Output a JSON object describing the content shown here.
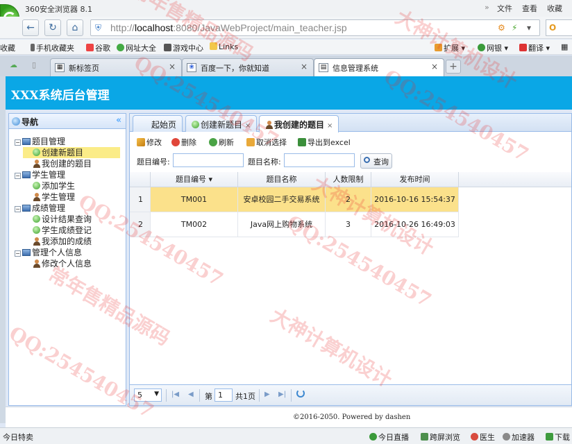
{
  "browser": {
    "app_title": "360安全浏览器 8.1",
    "menu": [
      "文件",
      "查看",
      "收藏"
    ],
    "menu_more": "»",
    "url_host": "localhost",
    "url_rest": ":8080/JavaWebProject/main_teacher.jsp",
    "url_scheme": "http://",
    "bookmarks": [
      "收藏",
      "手机收藏夹",
      "谷歌",
      "网址大全",
      "游戏中心",
      "Links"
    ],
    "bookmark_right": [
      "扩展",
      "网银",
      "翻译"
    ],
    "tabs": [
      {
        "label": "新标签页"
      },
      {
        "label": "百度一下，你就知道"
      },
      {
        "label": "信息管理系统"
      }
    ],
    "tab_close": "×",
    "new_tab": "+"
  },
  "app": {
    "header_title": "XXX系统后台管理",
    "nav_title": "导航",
    "nav_collapse": "«",
    "tree": [
      {
        "label": "题目管理",
        "type": "group"
      },
      {
        "label": "创建新题目",
        "type": "ok"
      },
      {
        "label": "我创建的题目",
        "type": "user"
      },
      {
        "label": "学生管理",
        "type": "group"
      },
      {
        "label": "添加学生",
        "type": "ok"
      },
      {
        "label": "学生管理",
        "type": "user"
      },
      {
        "label": "成绩管理",
        "type": "group"
      },
      {
        "label": "设计结果查询",
        "type": "ok"
      },
      {
        "label": "学生成绩登记",
        "type": "ok"
      },
      {
        "label": "我添加的成绩",
        "type": "user"
      },
      {
        "label": "管理个人信息",
        "type": "group"
      },
      {
        "label": "修改个人信息",
        "type": "user"
      }
    ],
    "panel_tabs": [
      "起始页",
      "创建新题目",
      "我创建的题目"
    ],
    "panel_tab_close": "×",
    "toolbar": {
      "edit": "修改",
      "delete": "删除",
      "refresh": "刷新",
      "cancel_select": "取消选择",
      "export": "导出到excel"
    },
    "query": {
      "id_label": "题目编号:",
      "name_label": "题目名称:",
      "search_btn": "查询",
      "id_value": "",
      "name_value": ""
    },
    "grid": {
      "columns": [
        "题目编号",
        "题目名称",
        "人数限制",
        "发布时间"
      ],
      "sort_indicator": "▾",
      "rows": [
        {
          "num": "1",
          "id": "TM001",
          "name": "安卓校园二手交易系统",
          "limit": "2",
          "time": "2016-10-16 15:54:37"
        },
        {
          "num": "2",
          "id": "TM002",
          "name": "Java网上购物系统",
          "limit": "3",
          "time": "2016-10-26 16:49:03"
        }
      ]
    },
    "pager": {
      "page_size": "5",
      "page_prefix": "第",
      "page_value": "1",
      "page_total": "共1页"
    },
    "footer": "©2016-2050. Powered by dashen"
  },
  "statusbar": {
    "left": "今日特卖",
    "items": [
      "今日直播",
      "跨屏浏览",
      "医生",
      "加速器",
      "下载"
    ]
  },
  "watermark": [
    "大神计算机设计",
    "常年售精品源码",
    "QQ:254540457"
  ]
}
